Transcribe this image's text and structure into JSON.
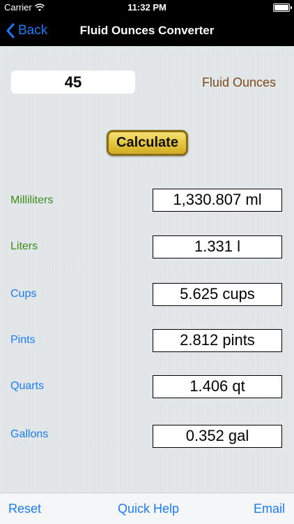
{
  "status_bar": {
    "carrier": "Carrier",
    "time": "11:32 PM",
    "wifi_icon": "wifi-icon",
    "battery_icon": "battery-icon"
  },
  "nav": {
    "back_label": "Back",
    "back_icon": "chevron-left-icon",
    "title": "Fluid Ounces Converter",
    "accent_color": "#1a7cf5"
  },
  "input": {
    "value": "45",
    "unit_label": "Fluid Ounces",
    "unit_label_color": "#7a4a17"
  },
  "calculate_label": "Calculate",
  "results": [
    {
      "label": "Milliliters",
      "value": "1,330.807 ml",
      "label_color": "#3f8a1c"
    },
    {
      "label": "Liters",
      "value": "1.331 l",
      "label_color": "#3f8a1c"
    },
    {
      "label": "Cups",
      "value": "5.625 cups",
      "label_color": "#1a7cf5"
    },
    {
      "label": "Pints",
      "value": "2.812 pints",
      "label_color": "#1a7cf5"
    },
    {
      "label": "Quarts",
      "value": "1.406 qt",
      "label_color": "#1a7cf5"
    },
    {
      "label": "Gallons",
      "value": "0.352 gal",
      "label_color": "#1a7cf5"
    }
  ],
  "toolbar": {
    "reset_label": "Reset",
    "quick_help_label": "Quick Help",
    "email_label": "Email"
  }
}
